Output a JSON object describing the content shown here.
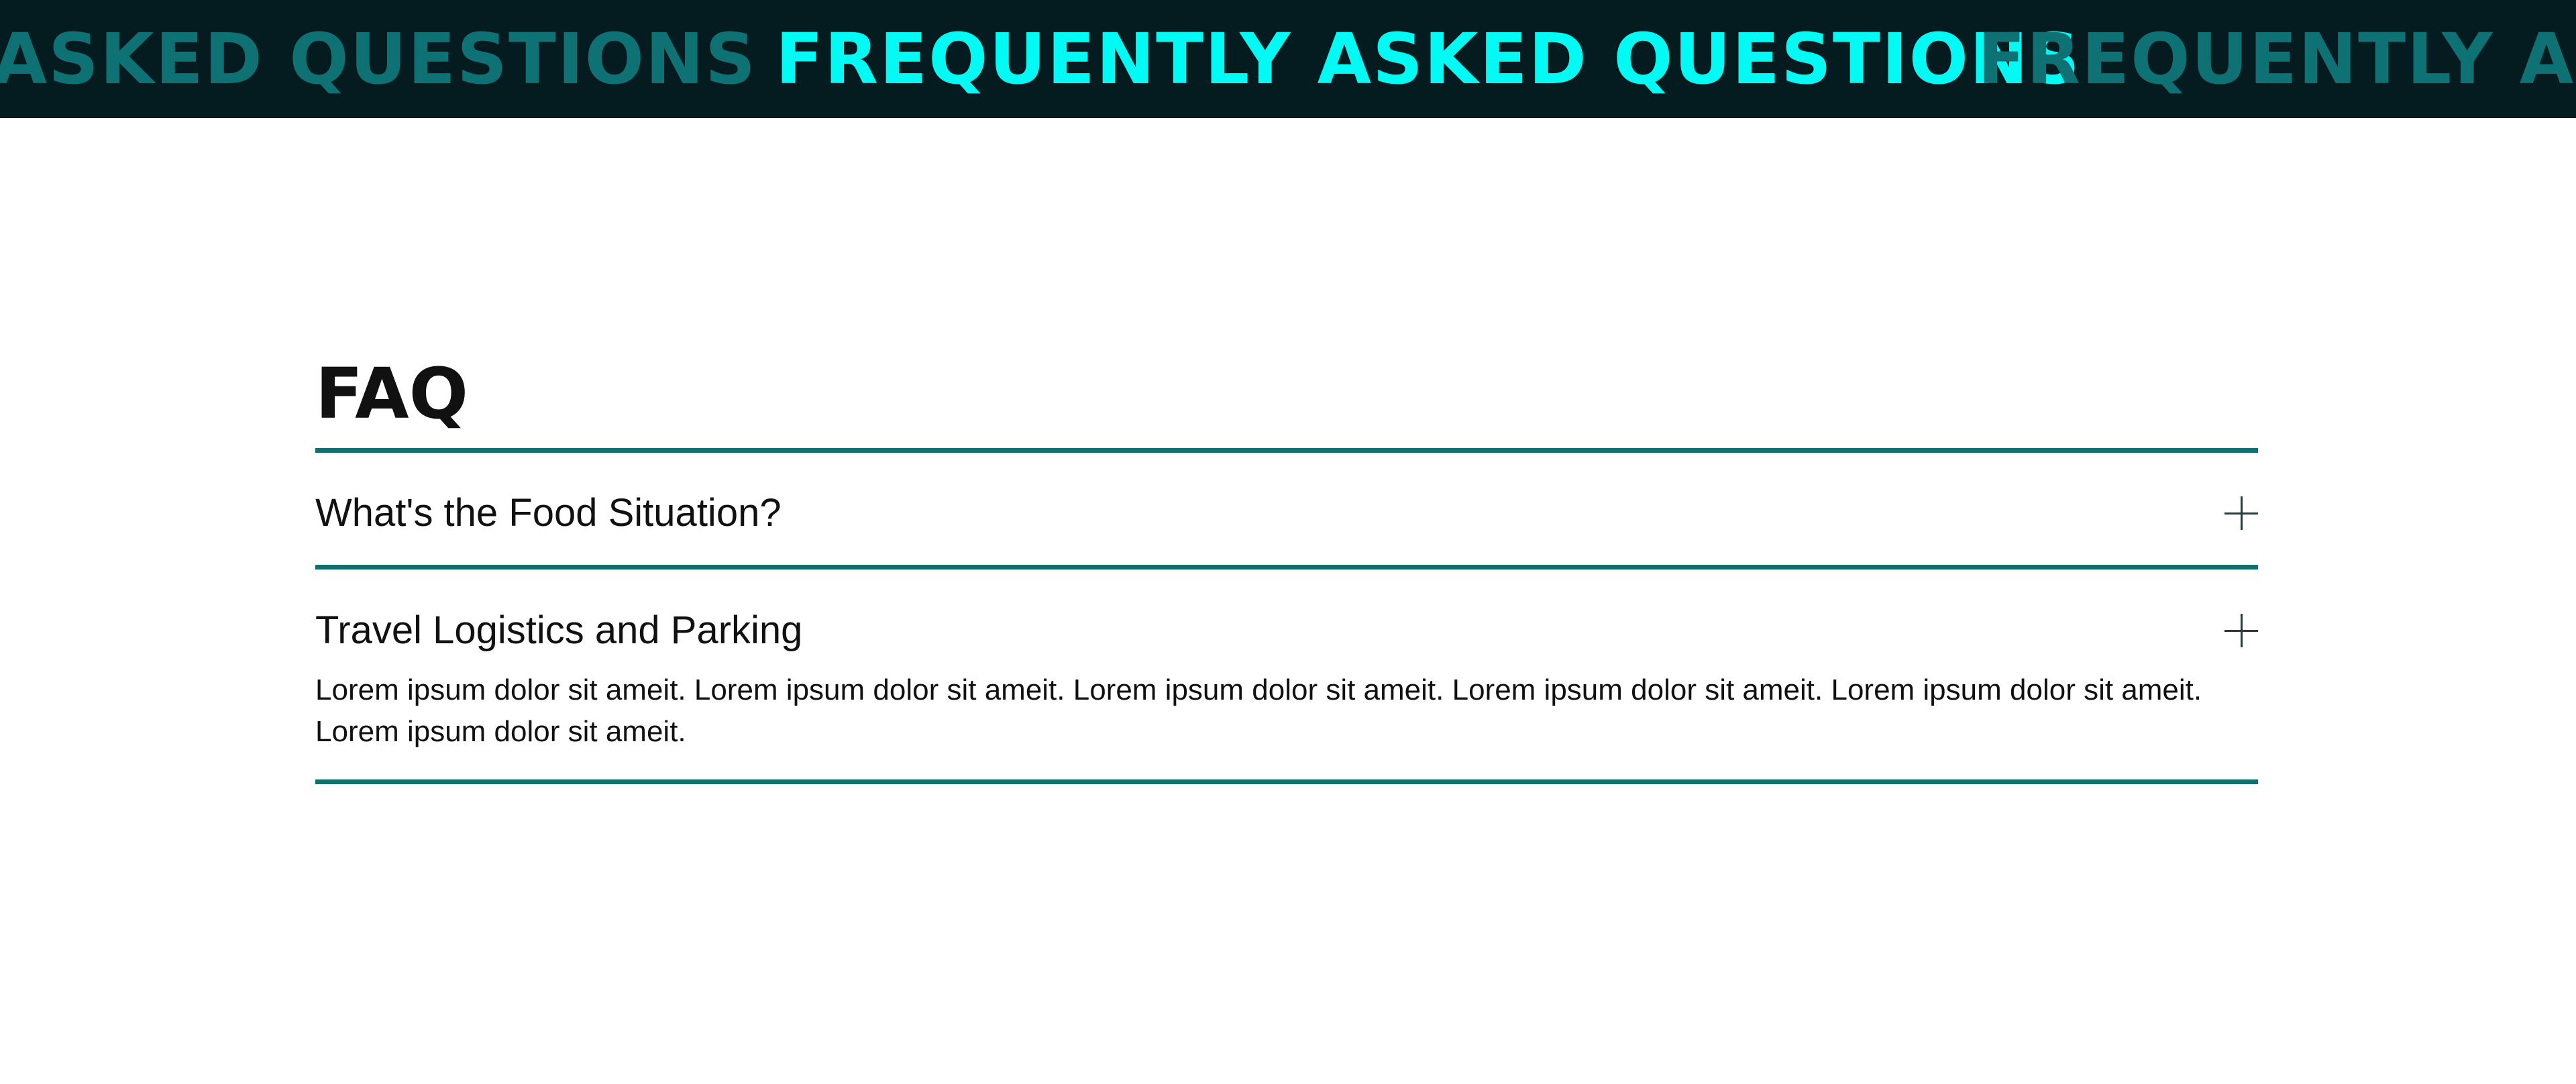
{
  "banner": {
    "text": "FREQUENTLY ASKED QUESTIONS",
    "colors": {
      "background": "#041c1f",
      "active_text": "#00fbf4",
      "dim_text": "#0e7173"
    }
  },
  "faq": {
    "title": "FAQ",
    "divider_color": "#10706e",
    "items": [
      {
        "question": "What's the Food Situation?",
        "icon": "plus-icon",
        "expanded": false,
        "answer": ""
      },
      {
        "question": "Travel Logistics and Parking",
        "icon": "plus-icon",
        "expanded": true,
        "answer": "Lorem ipsum dolor sit ameit. Lorem ipsum dolor sit ameit. Lorem ipsum dolor sit ameit. Lorem ipsum dolor sit ameit. Lorem ipsum dolor sit ameit. Lorem ipsum dolor sit ameit."
      }
    ]
  }
}
